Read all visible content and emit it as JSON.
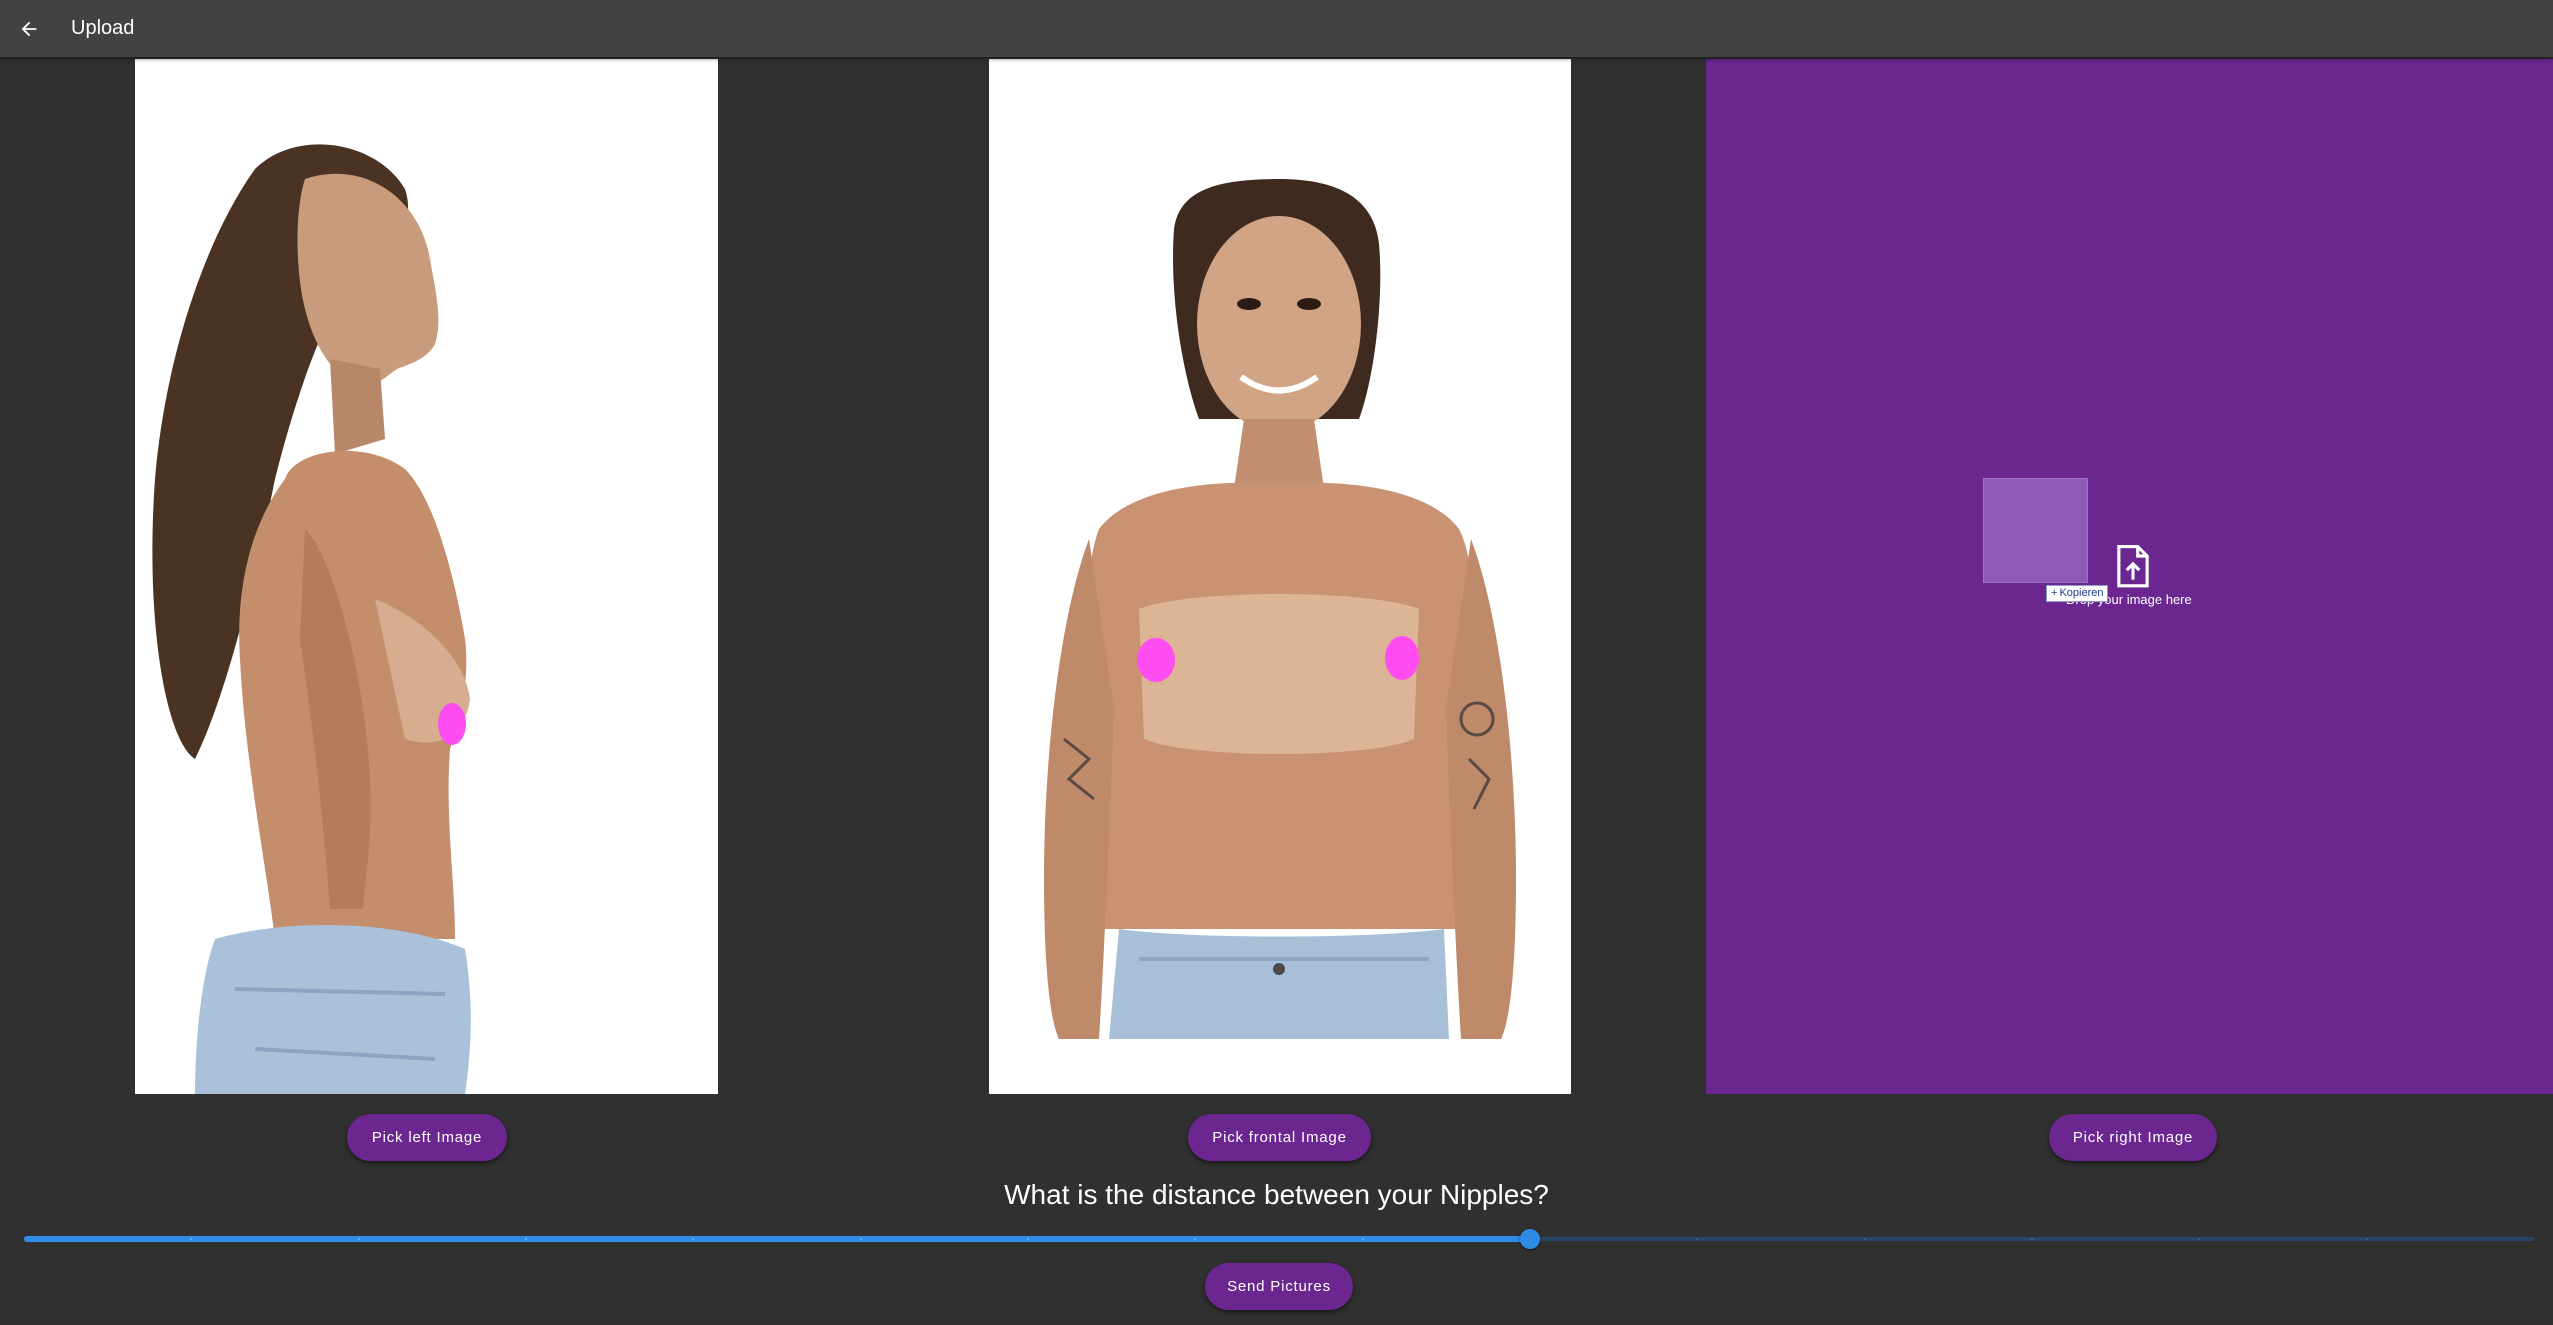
{
  "appbar": {
    "title": "Upload",
    "back_icon": "arrow-back-icon"
  },
  "panels": {
    "left": {
      "button_label": "Pick left Image",
      "image": "side-profile-photo"
    },
    "frontal": {
      "button_label": "Pick frontal Image",
      "image": "frontal-photo"
    },
    "right": {
      "button_label": "Pick right Image",
      "drop_text": "Drop your image here",
      "drop_icon": "file-upload-icon",
      "copy_badge": "Kopieren",
      "background": "#6b2690"
    }
  },
  "question": "What is the distance between your Nipples?",
  "slider": {
    "value_fraction": 0.6,
    "divisions": 15,
    "active_color": "#2f8ce6",
    "inactive_color": "#25476a"
  },
  "send_button": {
    "label": "Send Pictures"
  },
  "colors": {
    "accent": "#6b2690",
    "marker": "#ff4df2",
    "background": "#303030",
    "appbar": "#424242"
  }
}
